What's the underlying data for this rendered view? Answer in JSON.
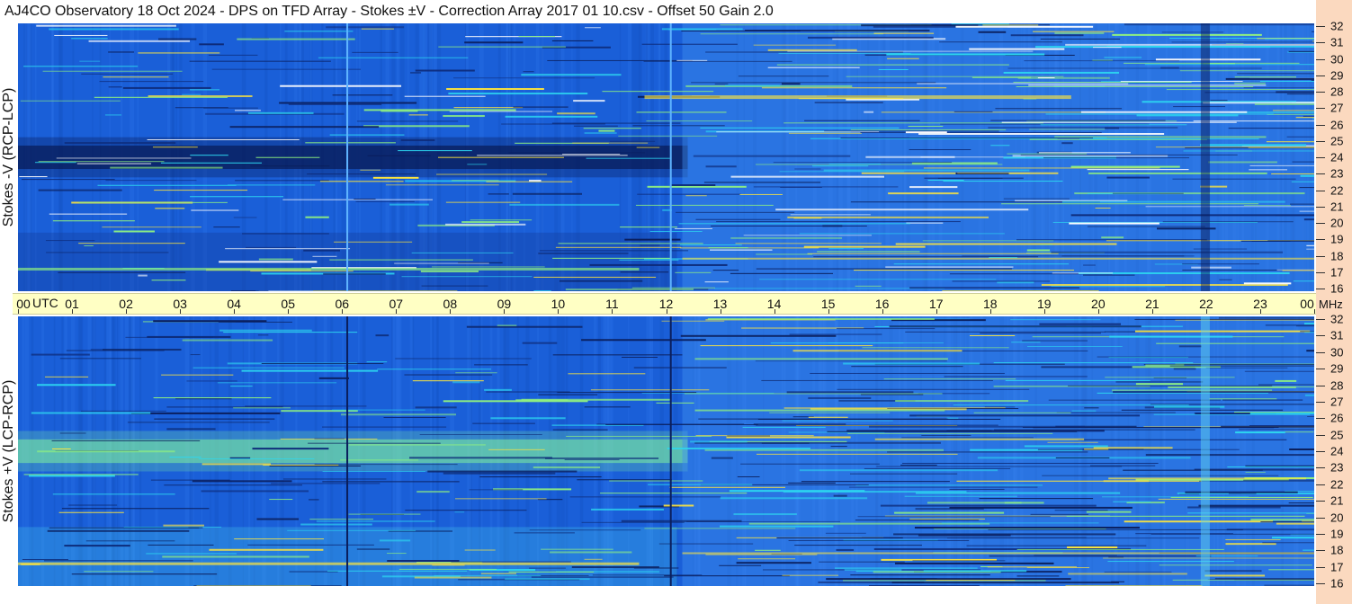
{
  "title": "AJ4CO Observatory  18 Oct 2024  -  DPS on TFD Array  -  Stokes ±V  -  Correction Array 2017 01 10.csv  -  Offset 50  Gain 2.0",
  "chart_data": [
    {
      "type": "heatmap",
      "name": "spectrogram-top",
      "ylabel": "Stokes -V (RCP-LCP)",
      "x_unit": "UTC",
      "x_ticks": [
        "00",
        "01",
        "02",
        "03",
        "04",
        "05",
        "06",
        "07",
        "08",
        "09",
        "10",
        "11",
        "12",
        "13",
        "14",
        "15",
        "16",
        "17",
        "18",
        "19",
        "20",
        "21",
        "22",
        "23",
        "00"
      ],
      "xlim": [
        0,
        24
      ],
      "y_unit": "MHz",
      "y_ticks": [
        16,
        17,
        18,
        19,
        20,
        21,
        22,
        23,
        24,
        25,
        26,
        27,
        28,
        29,
        30,
        31,
        32
      ],
      "ylim": [
        16,
        32
      ],
      "colors": {
        "base": "#1a5fd8",
        "low": "#0a1e5c",
        "high": "#ffe63c"
      }
    },
    {
      "type": "heatmap",
      "name": "spectrogram-bottom",
      "ylabel": "Stokes +V (LCP-RCP)",
      "x_unit": "UTC",
      "x_ticks": [
        "00",
        "01",
        "02",
        "03",
        "04",
        "05",
        "06",
        "07",
        "08",
        "09",
        "10",
        "11",
        "12",
        "13",
        "14",
        "15",
        "16",
        "17",
        "18",
        "19",
        "20",
        "21",
        "22",
        "23",
        "00"
      ],
      "xlim": [
        0,
        24
      ],
      "y_unit": "MHz",
      "y_ticks": [
        16,
        17,
        18,
        19,
        20,
        21,
        22,
        23,
        24,
        25,
        26,
        27,
        28,
        29,
        30,
        31,
        32
      ],
      "ylim": [
        16,
        32
      ],
      "colors": {
        "base": "#1a5fd8",
        "low": "#0a1e5c",
        "high": "#ffe63c"
      }
    }
  ],
  "time_axis": {
    "utc_label": "UTC",
    "mhz_label": "MHz"
  }
}
